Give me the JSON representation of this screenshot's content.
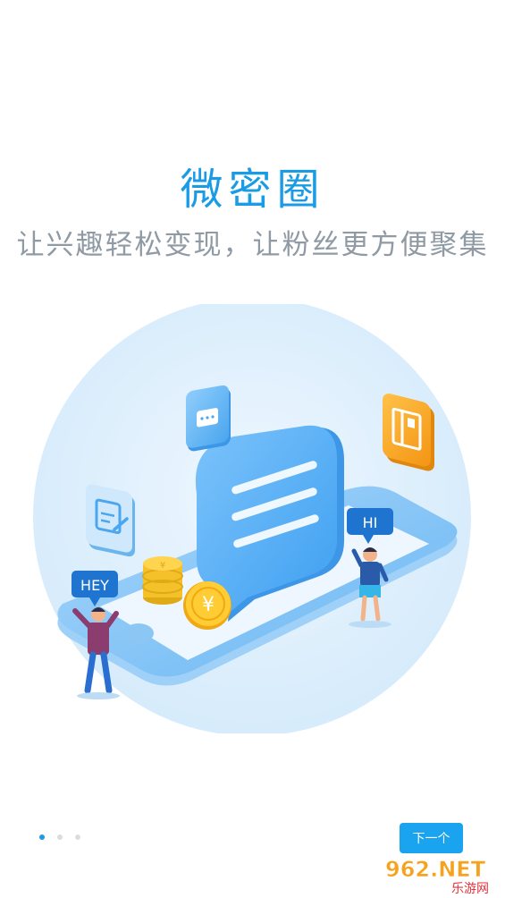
{
  "header": {
    "title": "微密圈",
    "subtitle": "让兴趣轻松变现，让粉丝更方便聚集"
  },
  "illustration": {
    "bubble_left": "HEY",
    "bubble_right": "HI",
    "coin_symbol": "¥"
  },
  "pager": {
    "pages": 3,
    "active_index": 0
  },
  "footer": {
    "next_label": "下一个"
  },
  "watermark": {
    "brand": "962.NET",
    "sub": "乐游网"
  },
  "colors": {
    "accent": "#1a9be6",
    "subtitle": "#8f9aa4",
    "circle": "#dff0fd",
    "orange": "#f6a21b"
  }
}
